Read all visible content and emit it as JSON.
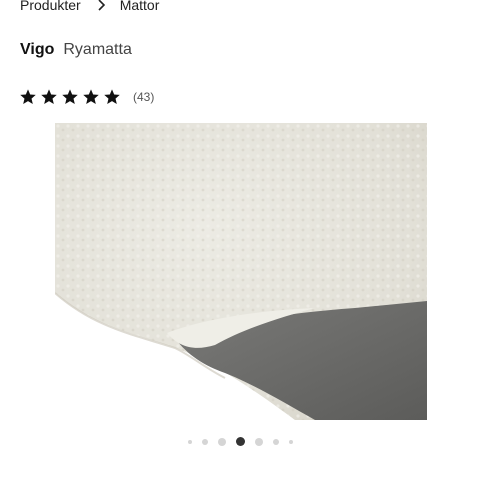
{
  "breadcrumb": {
    "items": [
      "Produkter",
      "Mattor"
    ]
  },
  "product": {
    "brand": "Vigo",
    "name": "Ryamatta"
  },
  "rating": {
    "stars": 5,
    "max_stars": 5,
    "count_label": "(43)"
  },
  "image": {
    "description_icon": "product-photo-rug",
    "rug_color": "#e6e4dc",
    "backing_color": "#6b6b69"
  },
  "carousel": {
    "total": 7,
    "active_index": 3
  }
}
